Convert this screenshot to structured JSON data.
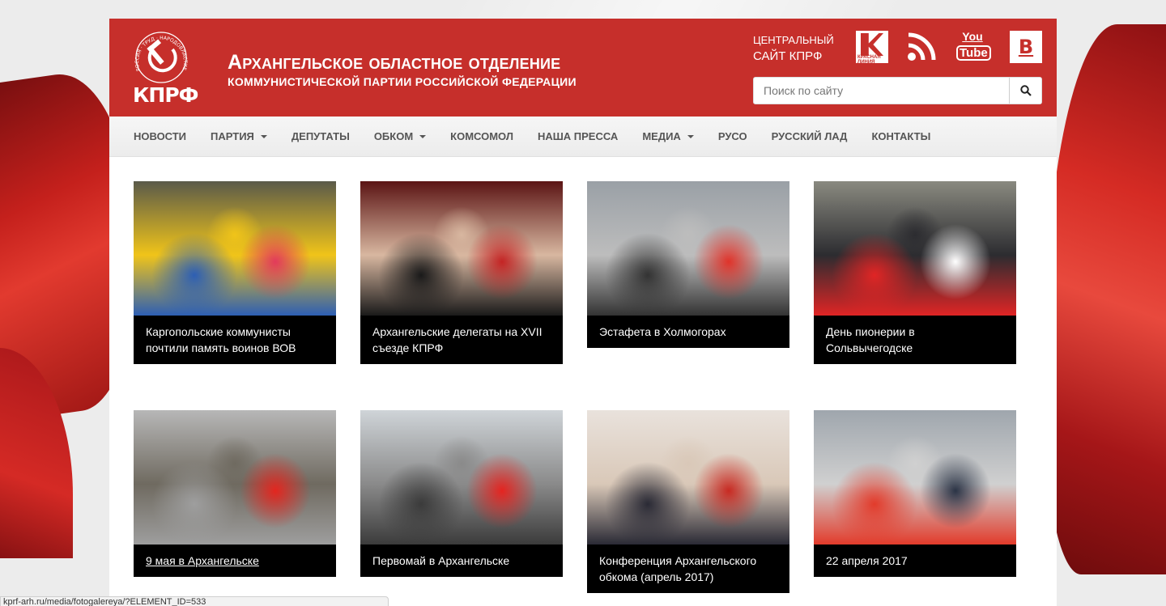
{
  "header": {
    "logo_text": "КПРФ",
    "logo_ring_text": "РОССИЯ · ТРУД · НАРОДОВЛАСТИЕ · СОЦИАЛИЗМ",
    "title_line1": "Архангельское областное отделение",
    "title_line2": "КОММУНИСТИЧЕСКОЙ ПАРТИИ РОССИЙСКОЙ ФЕДЕРАЦИИ",
    "central_line1": "Центральный",
    "central_line2": "сайт КПРФ",
    "krasnaya_liniya": "КРАСНАЯ ЛИНИЯ",
    "youtube_top": "You",
    "youtube_bottom": "Tube",
    "vk_label": "В",
    "search_placeholder": "Поиск по сайту"
  },
  "nav": {
    "items": [
      {
        "label": "НОВОСТИ",
        "dropdown": false
      },
      {
        "label": "ПАРТИЯ",
        "dropdown": true
      },
      {
        "label": "ДЕПУТАТЫ",
        "dropdown": false
      },
      {
        "label": "ОБКОМ",
        "dropdown": true
      },
      {
        "label": "КОМСОМОЛ",
        "dropdown": false
      },
      {
        "label": "НАША ПРЕССА",
        "dropdown": false
      },
      {
        "label": "МЕДИА",
        "dropdown": true
      },
      {
        "label": "РУСО",
        "dropdown": false
      },
      {
        "label": "РУССКИЙ ЛАД",
        "dropdown": false
      },
      {
        "label": "КОНТАКТЫ",
        "dropdown": false
      }
    ]
  },
  "gallery": [
    {
      "caption": "Каргопольские коммунисты почтили память воинов ВОВ",
      "palette": [
        "#5a5a4a",
        "#e23a5b",
        "#2d5fb4",
        "#f0c419"
      ]
    },
    {
      "caption": "Архангельские делегаты на XVII съезде КПРФ",
      "palette": [
        "#5b1414",
        "#c42424",
        "#1a1a1a",
        "#d8b7a0"
      ]
    },
    {
      "caption": "Эстафета в Холмогорах",
      "palette": [
        "#9aa0a6",
        "#e0332a",
        "#333333",
        "#bdbdbd"
      ]
    },
    {
      "caption": "День пионерии в Сольвычегодске",
      "palette": [
        "#8a8a80",
        "#ffffff",
        "#e02525",
        "#2c2c30"
      ]
    },
    {
      "caption": "9 мая в Архангельске",
      "palette": [
        "#b7b7b7",
        "#e3261f",
        "#9e9e9e",
        "#6f6a60"
      ]
    },
    {
      "caption": "Первомай в Архангельске",
      "palette": [
        "#cfd4d8",
        "#e52420",
        "#3b3b3b",
        "#8a8a8a"
      ]
    },
    {
      "caption": "Конференция Архангельского обкома (апрель 2017)",
      "palette": [
        "#e9e2dc",
        "#c82a22",
        "#2a2a35",
        "#d9c8b8"
      ]
    },
    {
      "caption": "22 апреля 2017",
      "palette": [
        "#9fa6ad",
        "#2b3446",
        "#e23b2b",
        "#d0d0d0"
      ]
    }
  ],
  "status_bar": {
    "url": "kprf-arh.ru/media/fotogalereya/?ELEMENT_ID=533"
  }
}
